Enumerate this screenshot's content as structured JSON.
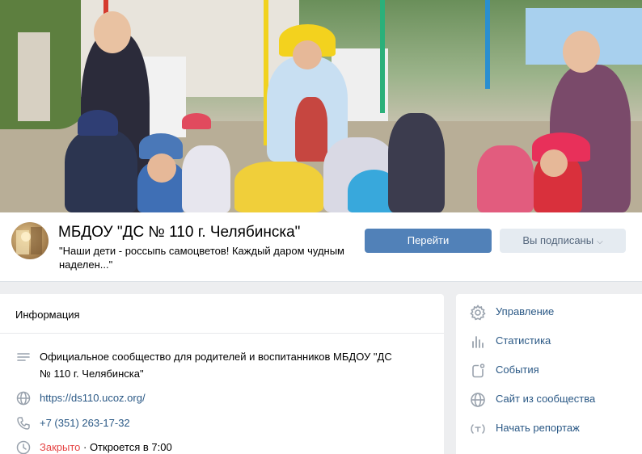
{
  "cover": {
    "image": "group-cover-photo"
  },
  "header": {
    "title": "МБДОУ \"ДС № 110 г. Челябинска\"",
    "status": "\"Наши дети - россыпь самоцветов! Каждый даром чудным наделен...\"",
    "go_button": "Перейти",
    "subscribed_button": "Вы подписаны"
  },
  "info": {
    "title": "Информация",
    "description": "Официальное сообщество для родителей и воспитанников МБДОУ \"ДС № 110 г. Челябинска\"",
    "site": "https://ds110.ucoz.org/",
    "phone": "+7 (351) 263-17-32",
    "hours_status": "Закрыто",
    "hours_next": " · Откроется в 7:00"
  },
  "menu": [
    {
      "label": "Управление",
      "icon": "gear-icon"
    },
    {
      "label": "Статистика",
      "icon": "stats-icon"
    },
    {
      "label": "События",
      "icon": "events-icon"
    },
    {
      "label": "Сайт из сообщества",
      "icon": "globe-icon"
    },
    {
      "label": "Начать репортаж",
      "icon": "broadcast-icon"
    }
  ],
  "colors": {
    "accent": "#5181b8",
    "link": "#2a5885",
    "closed": "#e64646",
    "icon": "#99a2ad"
  }
}
